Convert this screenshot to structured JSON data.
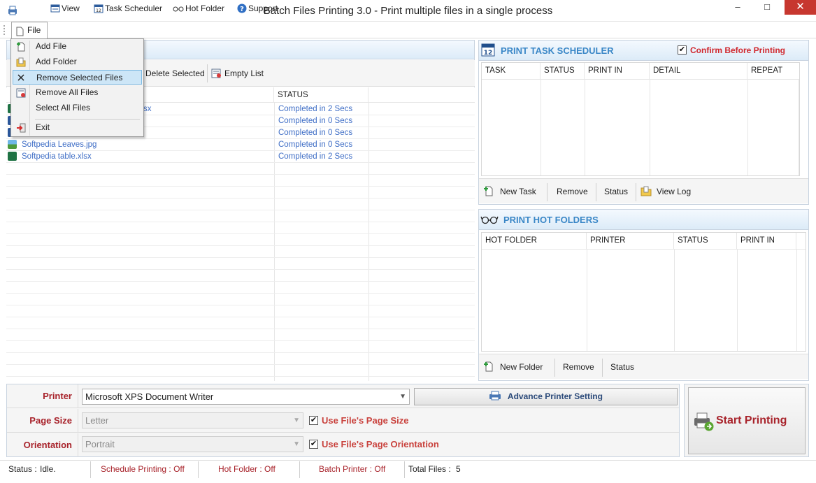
{
  "window": {
    "title": "Batch Files Printing 3.0 - Print multiple files in a single process",
    "minimize": "‒",
    "maximize": "□",
    "close": "✕"
  },
  "menubar": {
    "items": [
      {
        "label": "File",
        "icon": "file-icon"
      },
      {
        "label": "View",
        "icon": "view-icon"
      },
      {
        "label": "Task Scheduler",
        "icon": "calendar-icon"
      },
      {
        "label": "Hot Folder",
        "icon": "glasses-icon"
      },
      {
        "label": "Support",
        "icon": "help-icon"
      }
    ]
  },
  "file_menu": {
    "items": [
      {
        "label": "Add File",
        "icon": "add-file-icon"
      },
      {
        "label": "Add Folder",
        "icon": "add-folder-icon"
      },
      {
        "label": "Remove Selected Files",
        "icon": "remove-icon",
        "highlighted": true
      },
      {
        "label": "Remove All Files",
        "icon": "remove-all-icon"
      },
      {
        "label": "Select All Files",
        "icon": ""
      },
      {
        "label": "Exit",
        "icon": "exit-icon"
      }
    ]
  },
  "left_toolbar": {
    "delete_selected": "Delete Selected",
    "empty_list": "Empty List"
  },
  "file_grid": {
    "status_header": "STATUS",
    "rows": [
      {
        "name": "sx",
        "status": "Completed in 2 Secs",
        "icon": "excel-icon"
      },
      {
        "name": "",
        "status": "Completed in 0 Secs",
        "icon": "doc-icon"
      },
      {
        "name": "",
        "status": "Completed in 0 Secs",
        "icon": "doc-icon"
      },
      {
        "name": "Softpedia Leaves.jpg",
        "status": "Completed in 0 Secs",
        "icon": "image-icon"
      },
      {
        "name": "Softpedia table.xlsx",
        "status": "Completed in 2 Secs",
        "icon": "excel-icon"
      }
    ]
  },
  "task_scheduler": {
    "title": "PRINT TASK SCHEDULER",
    "confirm_label": "Confirm Before Printing",
    "confirm_checked": true,
    "columns": [
      "TASK",
      "STATUS",
      "PRINT IN",
      "DETAIL",
      "REPEAT"
    ],
    "buttons": {
      "new_task": "New Task",
      "remove": "Remove",
      "status": "Status",
      "view_log": "View Log"
    }
  },
  "hot_folders": {
    "title": "PRINT HOT FOLDERS",
    "columns": [
      "HOT FOLDER",
      "PRINTER",
      "STATUS",
      "PRINT IN"
    ],
    "buttons": {
      "new_folder": "New Folder",
      "remove": "Remove",
      "status": "Status"
    }
  },
  "settings": {
    "printer_label": "Printer",
    "printer_value": "Microsoft XPS Document Writer",
    "advance_button": "Advance Printer Setting",
    "page_size_label": "Page Size",
    "page_size_value": "Letter",
    "use_page_size_label": "Use File's Page Size",
    "use_page_size_checked": true,
    "orientation_label": "Orientation",
    "orientation_value": "Portrait",
    "use_orientation_label": "Use File's Page Orientation",
    "use_orientation_checked": true
  },
  "start_button": "Start Printing",
  "statusbar": {
    "status_label": "Status :",
    "status_value": "Idle.",
    "schedule": "Schedule Printing : Off",
    "hot_folder": "Hot Folder : Off",
    "batch_printer": "Batch Printer : Off",
    "total_label": "Total Files :",
    "total_value": "5"
  },
  "colors": {
    "accent_blue": "#3a87c7",
    "label_red": "#a8232b",
    "link_blue": "#3f6ec6",
    "close_red": "#c7372f"
  }
}
